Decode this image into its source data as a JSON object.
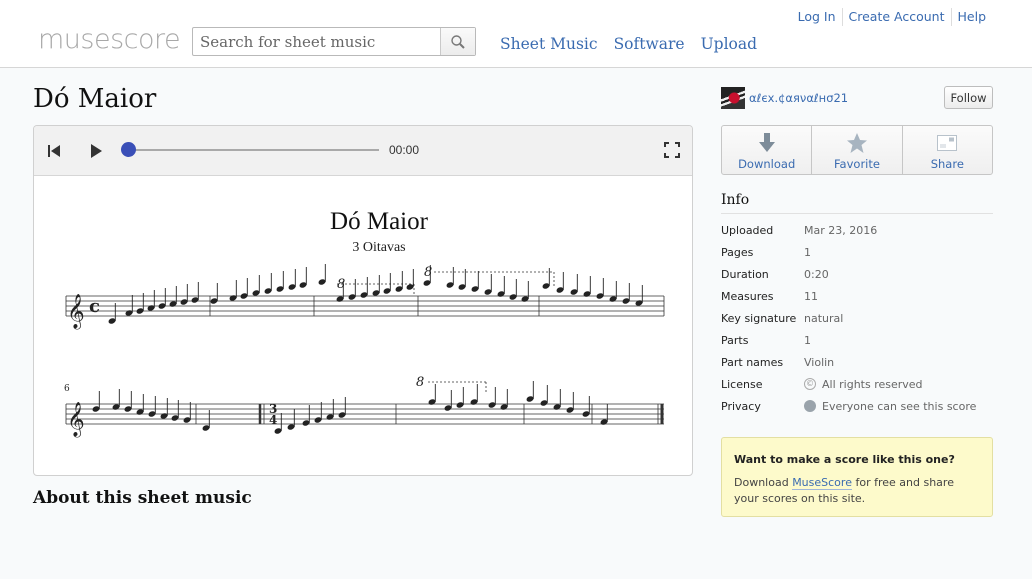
{
  "header": {
    "logo": "musescore",
    "search": {
      "placeholder": "Search for sheet music",
      "value": ""
    },
    "top_links": [
      "Log In",
      "Create Account",
      "Help"
    ],
    "main_nav": [
      "Sheet Music",
      "Software",
      "Upload"
    ]
  },
  "page": {
    "title": "Dó Maior",
    "about_heading": "About this sheet music"
  },
  "player": {
    "time": "00:00",
    "progress": 0,
    "score_title": "Dó Maior",
    "score_subtitle": "3 Oitavas",
    "system2_measure_number": "6",
    "ottava_mark": "8"
  },
  "author": {
    "name": "αℓєx.¢αяναℓнσ21",
    "follow_label": "Follow"
  },
  "actions": [
    {
      "label": "Download",
      "icon": "download-arrow-icon"
    },
    {
      "label": "Favorite",
      "icon": "star-icon"
    },
    {
      "label": "Share",
      "icon": "share-card-icon"
    }
  ],
  "info": {
    "title": "Info",
    "rows": [
      {
        "label": "Uploaded",
        "value": "Mar 23, 2016"
      },
      {
        "label": "Pages",
        "value": "1"
      },
      {
        "label": "Duration",
        "value": "0:20"
      },
      {
        "label": "Measures",
        "value": "11"
      },
      {
        "label": "Key signature",
        "value": "natural"
      },
      {
        "label": "Parts",
        "value": "1"
      },
      {
        "label": "Part names",
        "value": "Violin"
      },
      {
        "label": "License",
        "value": "All rights reserved",
        "icon": "copyright-icon"
      },
      {
        "label": "Privacy",
        "value": "Everyone can see this score",
        "icon": "globe-icon"
      }
    ]
  },
  "promo": {
    "title": "Want to make a score like this one?",
    "text_before": "Download ",
    "link": "MuseScore",
    "text_after": " for free and share your scores on this site."
  },
  "colors": {
    "link": "#3a6bb0",
    "player_knob": "#3a4fb7",
    "promo_bg": "#fdfacb"
  }
}
